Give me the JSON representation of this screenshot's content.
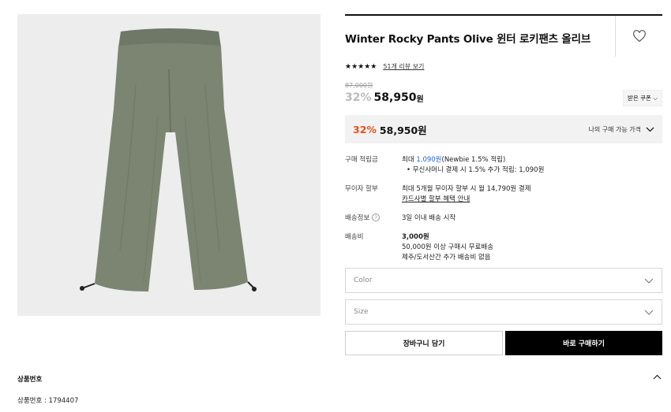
{
  "product": {
    "title": "Winter Rocky Pants Olive 윈터 로키팬츠 올리브",
    "stars": "★★★★★",
    "review_link": "51개 리뷰 보기",
    "original_price": "87,000원",
    "discount_rate": "32%",
    "sale_price": "58,950",
    "currency": "원",
    "coupon_label": "받은 쿠폰"
  },
  "best_price": {
    "discount_rate": "32%",
    "price": "58,950원",
    "label": "나의 구매 가능 가격"
  },
  "info": {
    "points": {
      "key": "구매 적립금",
      "prefix": "최대",
      "amount": "1,090원",
      "suffix": "(Newbie 1.5% 적립)",
      "bullet": "무신사머니 결제 시 1.5% 추가 적립: 1,090원"
    },
    "installment": {
      "key": "무이자 할부",
      "text": "최대 5개월 무이자 할부 시 월 14,790원 결제",
      "link": "카드사별 할부 혜택 안내"
    },
    "shipping_info": {
      "key": "배송정보",
      "help_icon": "?",
      "value": "3일 이내 배송 시작"
    },
    "shipping_fee": {
      "key": "배송비",
      "amount": "3,000원",
      "line1": "50,000원 이상 구매시 무료배송",
      "line2": "제주/도서산간 추가 배송비 없음"
    }
  },
  "options": {
    "color_placeholder": "Color",
    "size_placeholder": "Size"
  },
  "actions": {
    "cart": "장바구니 담기",
    "buy": "바로 구매하기"
  },
  "details": {
    "section_title": "상품번호",
    "product_number_line": "상품번호 : 1794407"
  },
  "icons": {
    "wishlist": "heart-outline-icon",
    "dropdown": "chevron-down-icon",
    "collapse": "chevron-up-icon",
    "help": "question-circle-icon"
  },
  "colors": {
    "discount_accent": "#f24c16",
    "points_blue": "#2563d8",
    "buy_button": "#000000",
    "pants_olive": "#7c8572"
  }
}
